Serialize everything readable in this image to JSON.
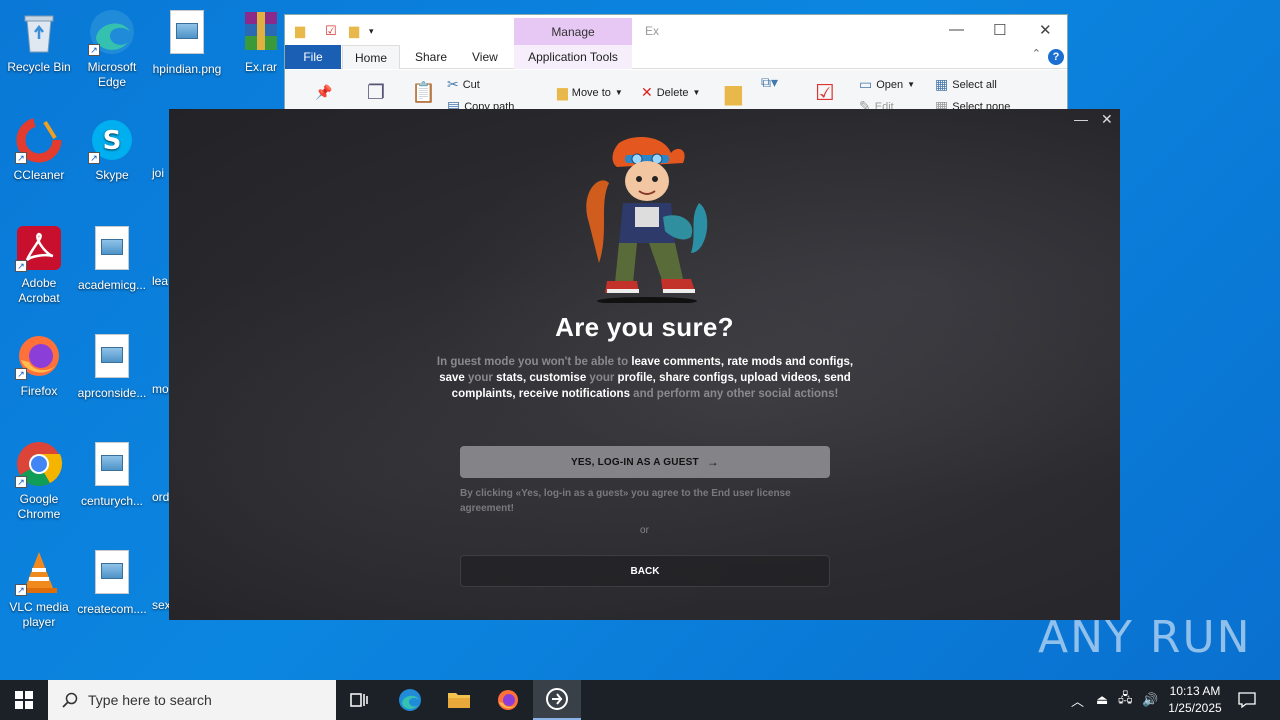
{
  "desktop": {
    "icons": [
      {
        "label": "Recycle Bin"
      },
      {
        "label": "Microsoft Edge"
      },
      {
        "label": "hpindian.png"
      },
      {
        "label": "Ex.rar"
      },
      {
        "label": "CCleaner"
      },
      {
        "label": "Skype"
      },
      {
        "label": "joi"
      },
      {
        "label": "Adobe Acrobat"
      },
      {
        "label": "academicg..."
      },
      {
        "label": "lea"
      },
      {
        "label": "Firefox"
      },
      {
        "label": "aprconside..."
      },
      {
        "label": "mo"
      },
      {
        "label": "Google Chrome"
      },
      {
        "label": "centurych..."
      },
      {
        "label": "ord"
      },
      {
        "label": "VLC media player"
      },
      {
        "label": "createcom...."
      },
      {
        "label": "sex"
      }
    ]
  },
  "explorer": {
    "manage_tab": "Manage",
    "title_partial": "Ex",
    "tabs": [
      "File",
      "Home",
      "Share",
      "View",
      "Application Tools"
    ],
    "ribbon": {
      "cut": "Cut",
      "copy_path": "Copy path",
      "move_to": "Move to",
      "delete": "Delete",
      "open": "Open",
      "edit": "Edit",
      "select_all": "Select all",
      "select_none": "Select none"
    }
  },
  "dialog": {
    "title": "Are you sure?",
    "text_parts": [
      {
        "t": "In guest mode you won't be able to ",
        "bold": false
      },
      {
        "t": "leave comments, rate mods and configs, save ",
        "bold": true
      },
      {
        "t": "your ",
        "bold": false
      },
      {
        "t": "stats, customise ",
        "bold": true
      },
      {
        "t": "your ",
        "bold": false
      },
      {
        "t": "profile, share configs, upload videos, send complaints, receive notifications ",
        "bold": true
      },
      {
        "t": "and perform any other social actions!",
        "bold": false
      }
    ],
    "guest_button": "YES, LOG-IN AS A GUEST",
    "agreement": "By clicking «Yes, log-in as a guest» you agree to the End user license agreement!",
    "or": "or",
    "back_button": "BACK"
  },
  "watermark": "ANY RUN",
  "taskbar": {
    "search_placeholder": "Type here to search",
    "time": "10:13 AM",
    "date": "1/25/2025"
  }
}
